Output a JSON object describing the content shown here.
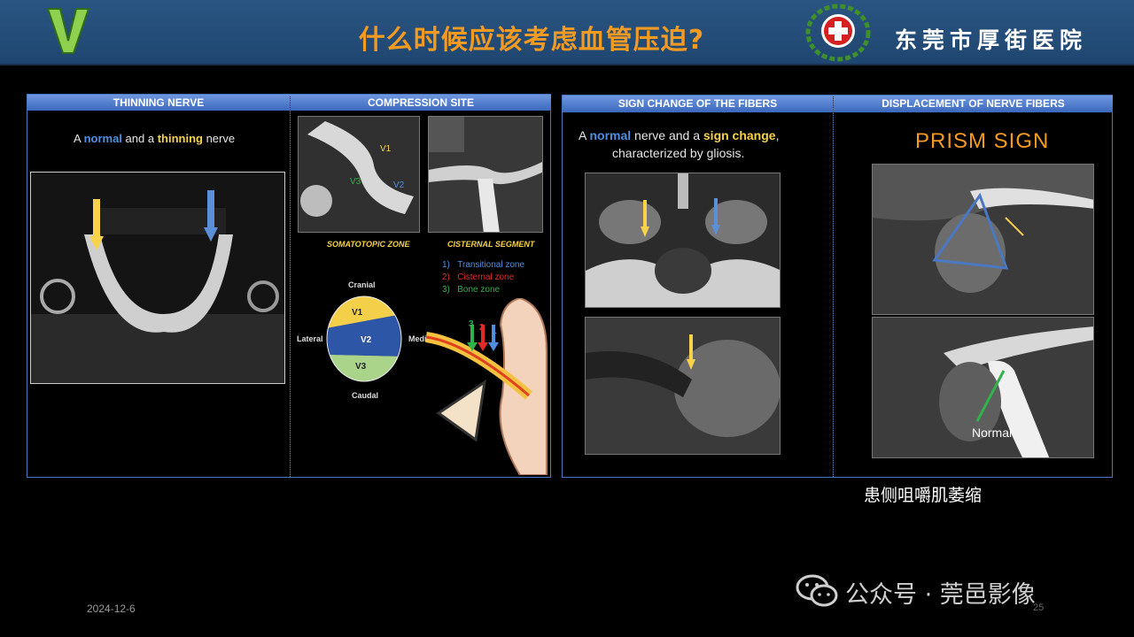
{
  "header": {
    "logo_letter": "V",
    "title": "什么时候应该考虑血管压迫?",
    "hospital_name": "东莞市厚街医院"
  },
  "panel_left": {
    "headers": [
      "THINNING NERVE",
      "COMPRESSION SITE"
    ],
    "thinning": {
      "prefix": "A ",
      "word1": "normal",
      "mid": " and a ",
      "word2": "thinning",
      "suffix": " nerve"
    },
    "labels": {
      "somatotopic": "SOMATOTOPIC ZONE",
      "cisternal": "CISTERNAL SEGMENT"
    },
    "mri_labels": {
      "v1": "V1",
      "v2": "V2",
      "v3": "V3"
    },
    "zones": [
      {
        "num": "1)",
        "label": "Transitional zone",
        "color": "#4e8fe0"
      },
      {
        "num": "2)",
        "label": "Cisternal zone",
        "color": "#e02a2a"
      },
      {
        "num": "3)",
        "label": "Bone zone",
        "color": "#2fb24a"
      }
    ],
    "directions": {
      "top": "Cranial",
      "bottom": "Caudal",
      "left": "Lateral",
      "right": "Medial"
    },
    "pie": {
      "v1": "V1",
      "v2": "V2",
      "v3": "V3"
    },
    "arrow_nums": [
      "3",
      "2",
      "1"
    ]
  },
  "panel_right": {
    "headers": [
      "SIGN CHANGE OF THE FIBERS",
      "DISPLACEMENT OF NERVE FIBERS"
    ],
    "sign": {
      "prefix": "A ",
      "word1": "normal",
      "mid": " nerve and a ",
      "word2": "sign change",
      "suffix": ",",
      "line2": "characterized by gliosis."
    },
    "prism": "PRISM SIGN",
    "normal_label": "Normal"
  },
  "caption": "患侧咀嚼肌萎缩",
  "footer": {
    "date": "2024-12-6",
    "page": "25",
    "watermark": "公众号 · 莞邑影像"
  },
  "colors": {
    "header_bg": "#1f4670",
    "title": "#f39a21",
    "panel_head": "#4a78c2",
    "accent_yellow": "#f7d24a",
    "accent_blue": "#4e8fe0"
  }
}
